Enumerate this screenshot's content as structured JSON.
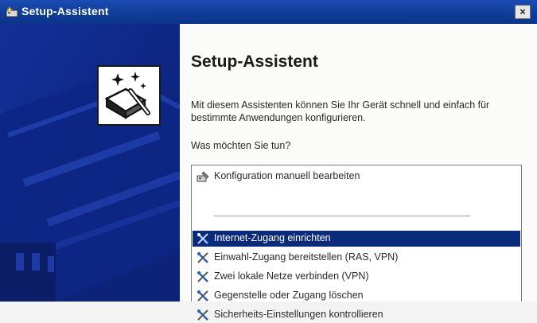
{
  "window": {
    "title": "Setup-Assistent",
    "close_label": "×"
  },
  "content": {
    "heading": "Setup-Assistent",
    "description": "Mit diesem Assistenten können Sie Ihr Gerät schnell und einfach für bestimmte Anwendungen konfigurieren.",
    "prompt": "Was möchten Sie tun?"
  },
  "options": [
    {
      "label": "Konfiguration manuell bearbeiten",
      "icon": "config-tool-icon"
    },
    {
      "label": "Internet-Zugang einrichten",
      "icon": "tools-icon",
      "selected": true
    },
    {
      "label": "Einwahl-Zugang bereitstellen (RAS, VPN)",
      "icon": "tools-icon"
    },
    {
      "label": "Zwei lokale Netze verbinden (VPN)",
      "icon": "tools-icon"
    },
    {
      "label": "Gegenstelle oder Zugang löschen",
      "icon": "tools-icon"
    },
    {
      "label": "Sicherheits-Einstellungen kontrollieren",
      "icon": "tools-icon"
    }
  ],
  "colors": {
    "title_bar": "#0f3e9a",
    "sidebar": "#0f2a8a",
    "selection": "#0a2a7c"
  }
}
